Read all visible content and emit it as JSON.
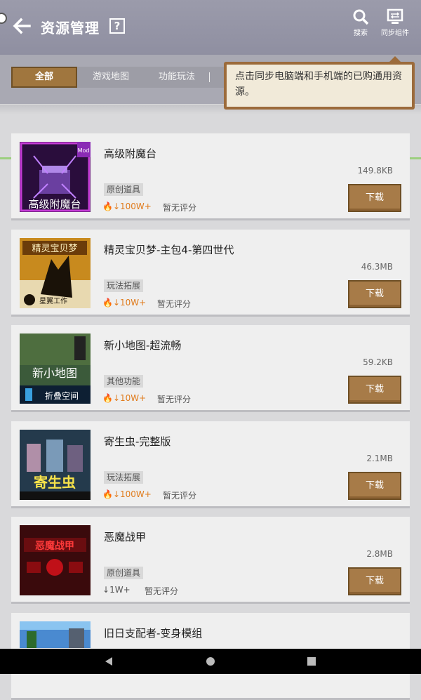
{
  "header": {
    "title": "资源管理",
    "help_label": "?",
    "search_label": "搜索",
    "sync_label": "同步组件"
  },
  "tabs": [
    {
      "label": "全部",
      "active": true
    },
    {
      "label": "游戏地图",
      "active": false
    },
    {
      "label": "功能玩法",
      "active": false
    }
  ],
  "tooltip": {
    "text": "点击同步电脑端和手机端的已购通用资源。"
  },
  "colors": {
    "accent": "#a77b48",
    "download_hot": "#e07b1c",
    "header": "#9b9bab"
  },
  "items": [
    {
      "title": "高级附魔台",
      "size": "149.8KB",
      "tag": "原创道具",
      "downloads": "100W+",
      "hot": true,
      "rating": "暂无评分",
      "button": "下载",
      "thumb_text": "高级附魔台",
      "thumb_badge": "Mod"
    },
    {
      "title": "精灵宝贝梦-主包4-第四世代",
      "size": "46.3MB",
      "tag": "玩法拓展",
      "downloads": "10W+",
      "hot": true,
      "rating": "暂无评分",
      "button": "下载",
      "thumb_text": "精灵宝贝梦",
      "thumb_badge": "星翼工作"
    },
    {
      "title": "新小地图-超流畅",
      "size": "59.2KB",
      "tag": "其他功能",
      "downloads": "10W+",
      "hot": true,
      "rating": "暂无评分",
      "button": "下载",
      "thumb_text": "新小地图",
      "thumb_badge": "折叠空间"
    },
    {
      "title": "寄生虫-完整版",
      "size": "2.1MB",
      "tag": "玩法拓展",
      "downloads": "100W+",
      "hot": true,
      "rating": "暂无评分",
      "button": "下载",
      "thumb_text": "寄生虫",
      "thumb_badge": ""
    },
    {
      "title": "恶魔战甲",
      "size": "2.8MB",
      "tag": "原创道具",
      "downloads": "1W+",
      "hot": false,
      "rating": "暂无评分",
      "button": "下载",
      "thumb_text": "恶魔战甲",
      "thumb_badge": ""
    },
    {
      "title": "旧日支配者-变身模组",
      "size": "",
      "tag": "",
      "downloads": "",
      "hot": false,
      "rating": "",
      "button": "",
      "thumb_text": "",
      "thumb_badge": ""
    }
  ]
}
